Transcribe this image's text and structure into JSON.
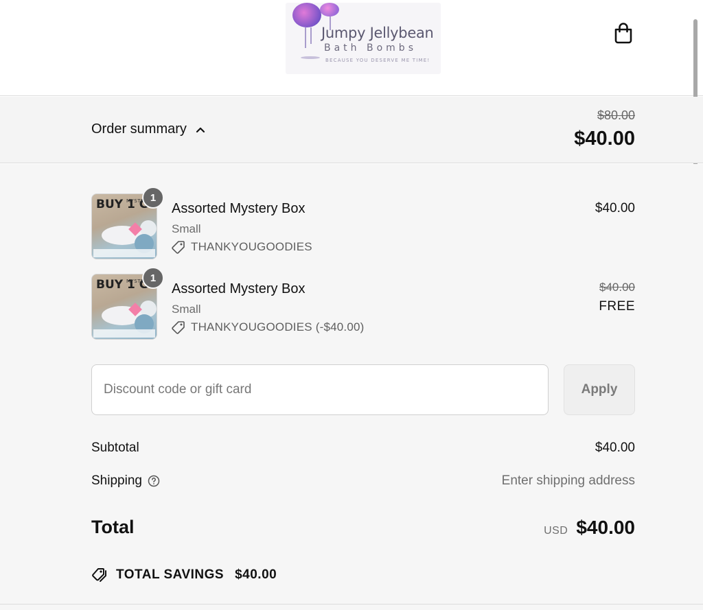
{
  "brand": {
    "name": "Jumpy Jellybean",
    "subtitle": "Bath Bombs",
    "tagline": "Because you deserve me time!"
  },
  "summary": {
    "toggle_label": "Order summary",
    "original_total": "$80.00",
    "total": "$40.00"
  },
  "items": [
    {
      "name": "Assorted Mystery Box",
      "variant": "Small",
      "code": "THANKYOUGOODIES",
      "quantity": "1",
      "price": "$40.00",
      "thumb_big": "BUY 1 GET 1",
      "thumb_small": "MYSTERY BOX"
    },
    {
      "name": "Assorted Mystery Box",
      "variant": "Small",
      "code": "THANKYOUGOODIES (-$40.00)",
      "quantity": "1",
      "original_price": "$40.00",
      "price": "FREE",
      "thumb_big": "BUY 1 GET 1",
      "thumb_small": "MYSTERY BOX"
    }
  ],
  "discount": {
    "placeholder": "Discount code or gift card",
    "value": "",
    "apply_label": "Apply"
  },
  "subtotal": {
    "label": "Subtotal",
    "value": "$40.00"
  },
  "shipping": {
    "label": "Shipping",
    "value": "Enter shipping address"
  },
  "total": {
    "label": "Total",
    "currency": "USD",
    "value": "$40.00"
  },
  "savings": {
    "label": "TOTAL SAVINGS",
    "value": "$40.00"
  },
  "icons": {
    "cart": "shopping-bag-icon",
    "toggle": "chevron-up-icon",
    "code": "tag-icon",
    "help": "question-circle-icon",
    "savings": "tags-icon"
  }
}
